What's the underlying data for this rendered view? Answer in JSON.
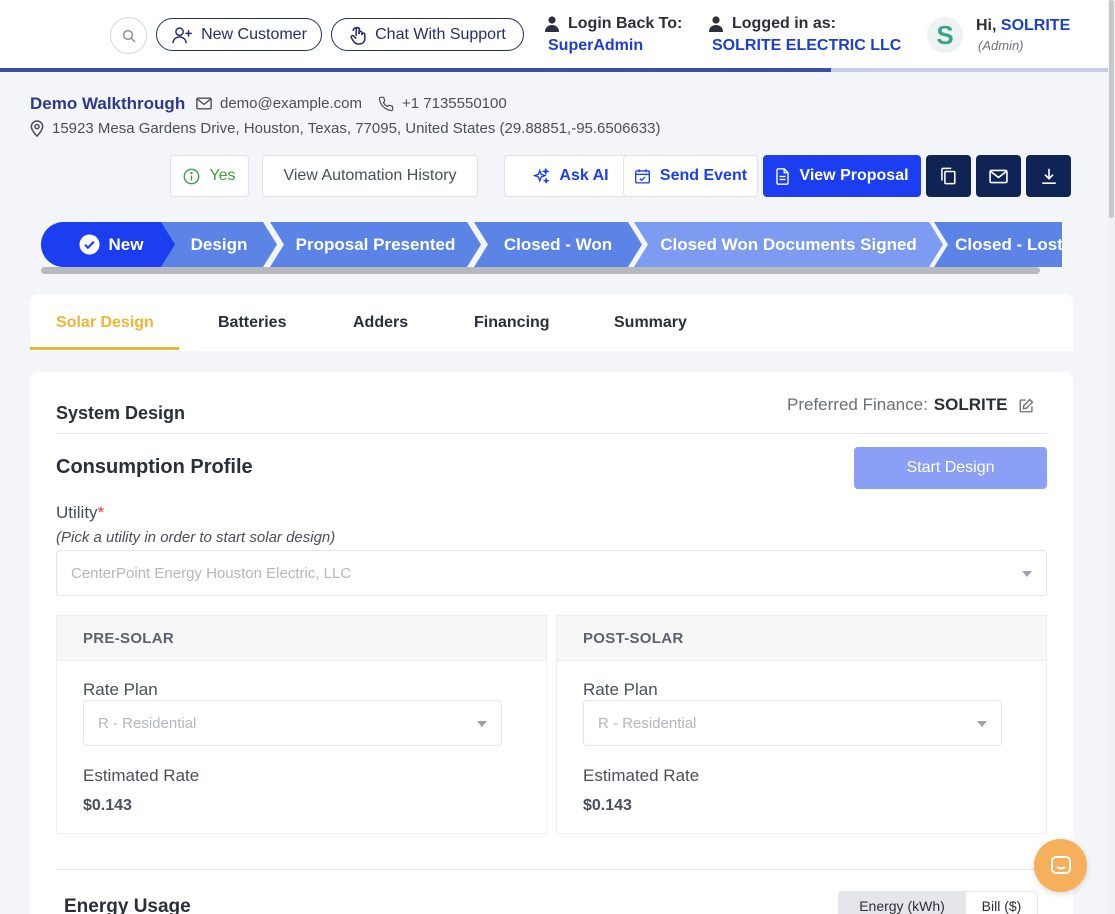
{
  "header": {
    "new_customer_label": "New Customer",
    "chat_support_label": "Chat With Support",
    "login_back_label": "Login Back To:",
    "login_back_value": "SuperAdmin",
    "logged_in_label": "Logged in as:",
    "logged_in_value": "SOLRITE ELECTRIC LLC",
    "avatar_letter": "S",
    "greeting_prefix": "Hi,",
    "greeting_name": "SOLRITE",
    "role": "(Admin)",
    "progress_fraction": 0.75
  },
  "customer": {
    "name": "Demo Walkthrough",
    "email": "demo@example.com",
    "phone": "+1 7135550100",
    "address": "15923 Mesa Gardens Drive, Houston, Texas, 77095, United States (29.88851,-95.6506633)"
  },
  "actions": {
    "yes_label": "Yes",
    "automation_label": "View Automation History",
    "ask_ai_label": "Ask AI",
    "send_event_label": "Send Event",
    "view_proposal_label": "View Proposal"
  },
  "stages": [
    {
      "label": "New",
      "active": true
    },
    {
      "label": "Design"
    },
    {
      "label": "Proposal Presented"
    },
    {
      "label": "Closed - Won"
    },
    {
      "label": "Closed Won Documents Signed"
    },
    {
      "label": "Closed - Lost"
    }
  ],
  "tabs": [
    "Solar Design",
    "Batteries",
    "Adders",
    "Financing",
    "Summary"
  ],
  "design": {
    "system_design_title": "System Design",
    "preferred_finance_label": "Preferred Finance:",
    "preferred_finance_value": "SOLRITE",
    "consumption_title": "Consumption Profile",
    "start_design_label": "Start Design",
    "utility_label": "Utility",
    "utility_required": "*",
    "utility_hint": "(Pick a utility in order to start solar design)",
    "utility_value": "CenterPoint Energy Houston Electric, LLC",
    "pre_solar": {
      "title": "PRE-SOLAR",
      "rate_plan_label": "Rate Plan",
      "rate_plan_value": "R - Residential",
      "estimated_rate_label": "Estimated Rate",
      "estimated_rate_value": "$0.143"
    },
    "post_solar": {
      "title": "POST-SOLAR",
      "rate_plan_label": "Rate Plan",
      "rate_plan_value": "R - Residential",
      "estimated_rate_label": "Estimated Rate",
      "estimated_rate_value": "$0.143"
    },
    "energy_usage_title": "Energy Usage",
    "toggle_energy_label": "Energy (kWh)",
    "toggle_bill_label": "Bill ($)"
  },
  "colors": {
    "accent": "#1a3ef0",
    "dark": "#0f2355",
    "tab_active": "#f0b533",
    "stage_new": "#1a3ef0",
    "stage": "#5b84e6",
    "stage_light": "#7d9bf0"
  }
}
